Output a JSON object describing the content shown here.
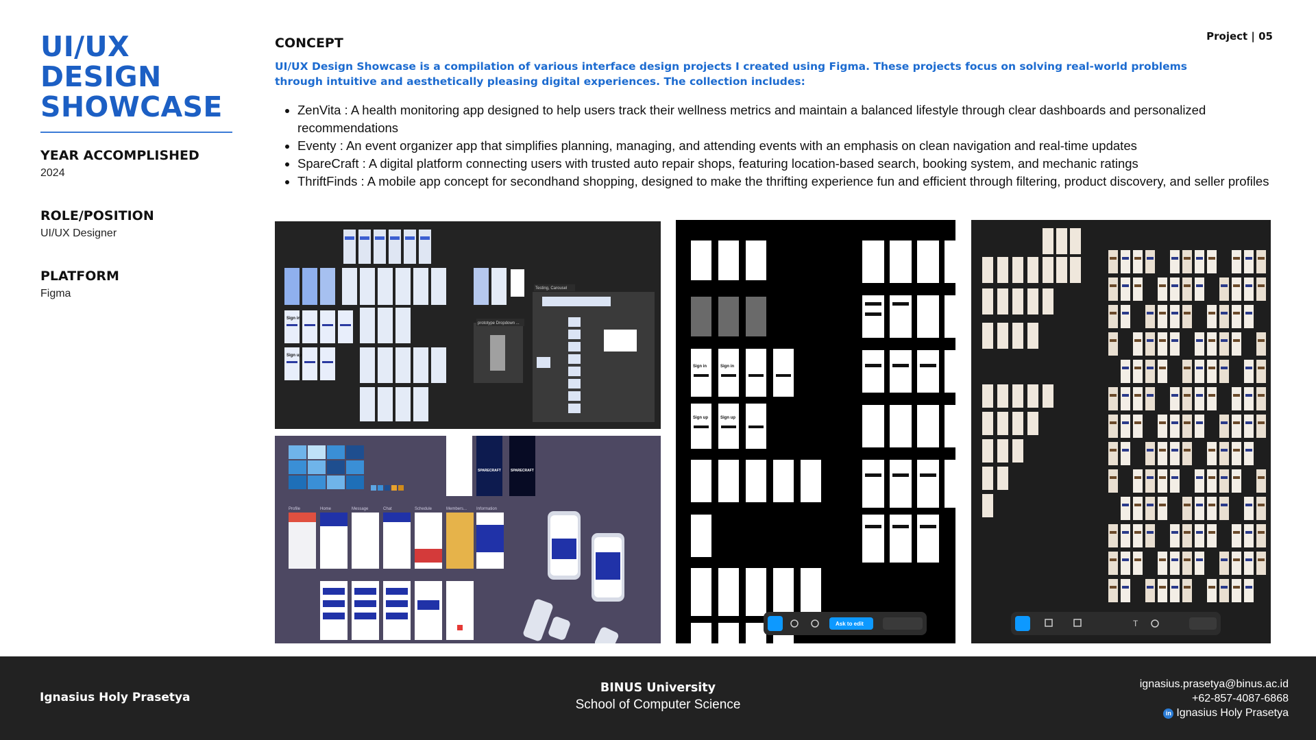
{
  "left": {
    "title_line1": "UI/UX DESIGN",
    "title_line2": "SHOWCASE",
    "meta": [
      {
        "label": "YEAR ACCOMPLISHED",
        "value": "2024"
      },
      {
        "label": "ROLE/POSITION",
        "value": "UI/UX Designer"
      },
      {
        "label": "PLATFORM",
        "value": "Figma"
      }
    ]
  },
  "project_tag": "Project | 05",
  "concept": {
    "title": "CONCEPT",
    "intro": "UI/UX Design Showcase is a compilation of various interface design projects I created using Figma. These projects focus on solving real-world problems through intuitive and aesthetically pleasing digital experiences. The collection includes:",
    "items": [
      "ZenVita : A health monitoring app designed to help users track their wellness metrics and maintain a balanced lifestyle through clear dashboards and personalized recommendations",
      "Eventy : An event organizer app that simplifies planning, managing, and attending events with an emphasis on clean navigation and real-time updates",
      "SpareCraft : A digital platform connecting users with trusted auto repair shops, featuring location-based search, booking system, and mechanic ratings",
      "ThriftFinds : A mobile app concept for secondhand shopping, designed to make the thrifting experience fun and efficient through filtering, product discovery, and seller profiles"
    ]
  },
  "panels": {
    "p1": {
      "section_a": "Testing, Carousel",
      "section_b": "prototype Dropdown ...",
      "signin": "Sign in",
      "signup": "Sign up"
    },
    "p2": {
      "brand": "SPARECRAFT",
      "frames": [
        "Profile",
        "Home",
        "Message",
        "Chat",
        "Schedule",
        "Members...",
        "Information"
      ]
    },
    "p3": {
      "signin": "Sign in",
      "signup": "Sign up",
      "ask_to_edit": "Ask to edit"
    },
    "p4": {}
  },
  "footer": {
    "name": "Ignasius Holy Prasetya",
    "university": "BINUS University",
    "school": "School of Computer Science",
    "email": "ignasius.prasetya@binus.ac.id",
    "phone": "+62-857-4087-6868",
    "linkedin_icon": "in",
    "linkedin": "Ignasius Holy Prasetya"
  },
  "colors": {
    "accent": "#1c5fc4",
    "footer_bg": "#222222"
  }
}
